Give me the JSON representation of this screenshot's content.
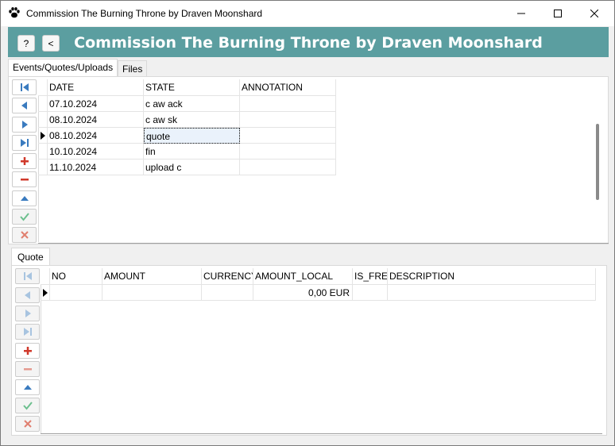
{
  "window": {
    "title": "Commission The Burning Throne by Draven Moonshard",
    "minimize_label": "minimize",
    "maximize_label": "maximize",
    "close_label": "close"
  },
  "banner": {
    "title": "Commission The Burning Throne by Draven Moonshard",
    "help_label": "?",
    "back_label": "<"
  },
  "tabs": [
    {
      "label": "Events/Quotes/Uploads",
      "active": true
    },
    {
      "label": "Files",
      "active": false
    }
  ],
  "events_grid": {
    "columns": [
      "DATE",
      "STATE",
      "ANNOTATION"
    ],
    "rows": [
      {
        "date": "07.10.2024",
        "state": "c aw ack",
        "annotation": ""
      },
      {
        "date": "08.10.2024",
        "state": "c aw sk",
        "annotation": ""
      },
      {
        "date": "08.10.2024",
        "state": "quote",
        "annotation": ""
      },
      {
        "date": "10.10.2024",
        "state": "fin",
        "annotation": ""
      },
      {
        "date": "11.10.2024",
        "state": "upload c",
        "annotation": ""
      }
    ],
    "current_row": 2
  },
  "quote_tab": {
    "label": "Quote"
  },
  "quote_grid": {
    "columns": [
      "NO",
      "AMOUNT",
      "CURRENCY",
      "AMOUNT_LOCAL",
      "IS_FREE",
      "DESCRIPTION"
    ],
    "rows": [
      {
        "no": "",
        "amount": "",
        "currency": "",
        "amount_local": "0,00 EUR",
        "is_free": "",
        "description": ""
      }
    ]
  },
  "icons": {
    "first": "first-record-icon",
    "prior": "prior-record-icon",
    "next": "next-record-icon",
    "last": "last-record-icon",
    "insert": "insert-record-icon",
    "delete": "delete-record-icon",
    "edit": "edit-record-icon",
    "post": "post-record-icon",
    "cancel": "cancel-record-icon"
  },
  "colors": {
    "banner": "#5b9ea0",
    "nav_blue": "#3a7bbf",
    "nav_red": "#d0392b",
    "check_green": "#6cbf8e",
    "cancel_red": "#e08070"
  }
}
